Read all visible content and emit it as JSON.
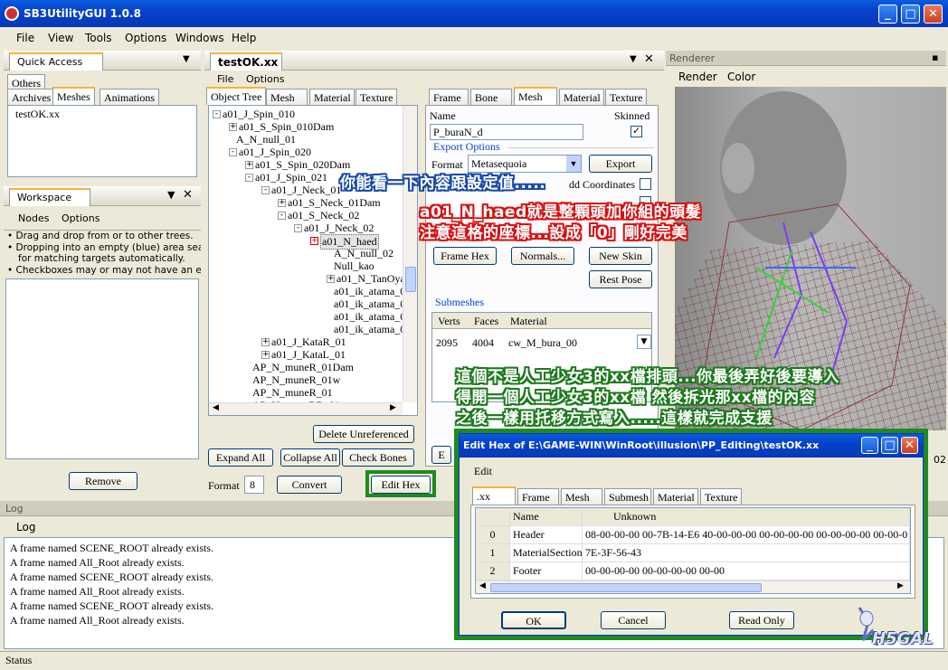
{
  "app": {
    "title": "SB3UtilityGUI 1.0.8"
  },
  "menu": [
    "File",
    "View",
    "Tools",
    "Options",
    "Windows",
    "Help"
  ],
  "quick_access": {
    "title": "Quick Access",
    "tabs": [
      "Others",
      "Archives",
      "Meshes",
      "Animations"
    ],
    "items": [
      "testOK.xx"
    ]
  },
  "workspace": {
    "title": "Workspace",
    "menu": [
      "Nodes",
      "Options"
    ],
    "hints": [
      "• Drag and drop from or to other trees.",
      "• Dropping into an empty (blue) area searche",
      "for matching targets automatically.",
      "• Checkboxes may or may not have an effec"
    ],
    "remove_label": "Remove"
  },
  "editor": {
    "doc_tab": "testOK.xx",
    "menu": [
      "File",
      "Options"
    ],
    "left_tabs": [
      "Object Tree",
      "Mesh",
      "Material",
      "Texture"
    ],
    "tree": [
      {
        "label": "a01_J_Spin_010",
        "indent": 0,
        "exp": "-"
      },
      {
        "label": "a01_S_Spin_010Dam",
        "indent": 1,
        "exp": "+"
      },
      {
        "label": "A_N_null_01",
        "indent": 1,
        "exp": ""
      },
      {
        "label": "a01_J_Spin_020",
        "indent": 1,
        "exp": "-"
      },
      {
        "label": "a01_S_Spin_020Dam",
        "indent": 2,
        "exp": "+"
      },
      {
        "label": "a01_J_Spin_021",
        "indent": 2,
        "exp": "-"
      },
      {
        "label": "a01_J_Neck_01",
        "indent": 3,
        "exp": "-"
      },
      {
        "label": "a01_S_Neck_01Dam",
        "indent": 4,
        "exp": "+"
      },
      {
        "label": "a01_S_Neck_02",
        "indent": 4,
        "exp": "-"
      },
      {
        "label": "a01_J_Neck_02",
        "indent": 5,
        "exp": "-"
      },
      {
        "label": "a01_N_haed",
        "indent": 6,
        "exp": "+",
        "selected": true
      },
      {
        "label": "A_N_null_02",
        "indent": 7,
        "exp": ""
      },
      {
        "label": "Null_kao",
        "indent": 7,
        "exp": ""
      },
      {
        "label": "a01_N_TanOya",
        "indent": 7,
        "exp": "+"
      },
      {
        "label": "a01_ik_atama_01",
        "indent": 7,
        "exp": ""
      },
      {
        "label": "a01_ik_atama_02",
        "indent": 7,
        "exp": ""
      },
      {
        "label": "a01_ik_atama_03",
        "indent": 7,
        "exp": ""
      },
      {
        "label": "a01_ik_atama_04",
        "indent": 7,
        "exp": ""
      },
      {
        "label": "a01_J_KataR_01",
        "indent": 3,
        "exp": "+"
      },
      {
        "label": "a01_J_KataL_01",
        "indent": 3,
        "exp": "+"
      },
      {
        "label": "AP_N_muneR_01Dam",
        "indent": 2,
        "exp": ""
      },
      {
        "label": "AP_N_muneR_01w",
        "indent": 2,
        "exp": ""
      },
      {
        "label": "AP_N_muneR_01",
        "indent": 2,
        "exp": ""
      },
      {
        "label": "AP_N_muneRR_01",
        "indent": 2,
        "exp": ""
      }
    ],
    "delete_unref": "Delete Unreferenced",
    "expand_all": "Expand All",
    "collapse_all": "Collapse All",
    "check_bones": "Check Bones",
    "format_label": "Format",
    "format_value": "8",
    "convert": "Convert",
    "edit_hex": "Edit Hex",
    "right_tabs": [
      "Frame",
      "Bone",
      "Mesh",
      "Material",
      "Texture"
    ],
    "name_label": "Name",
    "name_value": "P_buraN_d",
    "skinned_label": "Skinned",
    "export_options": "Export Options",
    "export_format_label": "Format",
    "export_format_value": "Metasequoia",
    "export_btn": "Export",
    "add_coords": "dd Coordinates",
    "frame_hex": "Frame Hex",
    "normals": "Normals...",
    "new_skin": "New Skin",
    "rest_pose": "Rest Pose",
    "submeshes": "Submeshes",
    "sub_cols": [
      "Verts",
      "Faces",
      "Material"
    ],
    "sub_row": [
      "2095",
      "4004",
      "cw_M_bura_00"
    ],
    "side_e": "E"
  },
  "renderer": {
    "title": "Renderer",
    "menu": [
      "Render",
      "Color"
    ],
    "side_num": "02"
  },
  "log": {
    "title": "Log",
    "menu": "Log",
    "lines": [
      "A frame named SCENE_ROOT already exists.",
      "A frame named All_Root already exists.",
      "A frame named SCENE_ROOT already exists.",
      "A frame named All_Root already exists.",
      "A frame named SCENE_ROOT already exists.",
      "A frame named All_Root already exists."
    ]
  },
  "status": "Status",
  "hex_dialog": {
    "title": "Edit Hex of E:\\GAME-WIN\\WinRoot\\illusion\\PP_Editing\\testOK.xx",
    "menu": "Edit",
    "tabs": [
      ".xx",
      "Frame",
      "Mesh",
      "Submesh",
      "Material",
      "Texture"
    ],
    "cols": [
      "Name",
      "Unknown"
    ],
    "rows": [
      {
        "idx": "0",
        "name": "Header",
        "val": "08-00-00-00 00-7B-14-E6 40-00-00-00 00-00-00-00 00-00-00-00 00-00-0"
      },
      {
        "idx": "1",
        "name": "MaterialSection",
        "val": "7E-3F-56-43"
      },
      {
        "idx": "2",
        "name": "Footer",
        "val": "00-00-00-00 00-00-00-00 00-00"
      }
    ],
    "ok": "OK",
    "cancel": "Cancel",
    "read_only": "Read Only"
  },
  "annotations": {
    "a1": "你能看一下內容跟設定值.....",
    "a2": "a01_N_haed就是整顆頭加你組的頭髮",
    "a3": "注意這格的座標...設成「0」剛好完美",
    "a4": "這個不是人工少女3的xx檔排頭...你最後弄好後要導入",
    "a5": "得開一個人工少女3的xx檔 然後拆光那xx檔的內容",
    "a6": "之後一樣用托移方式寫入.....這樣就完成支援"
  },
  "watermark": "H5GAL"
}
